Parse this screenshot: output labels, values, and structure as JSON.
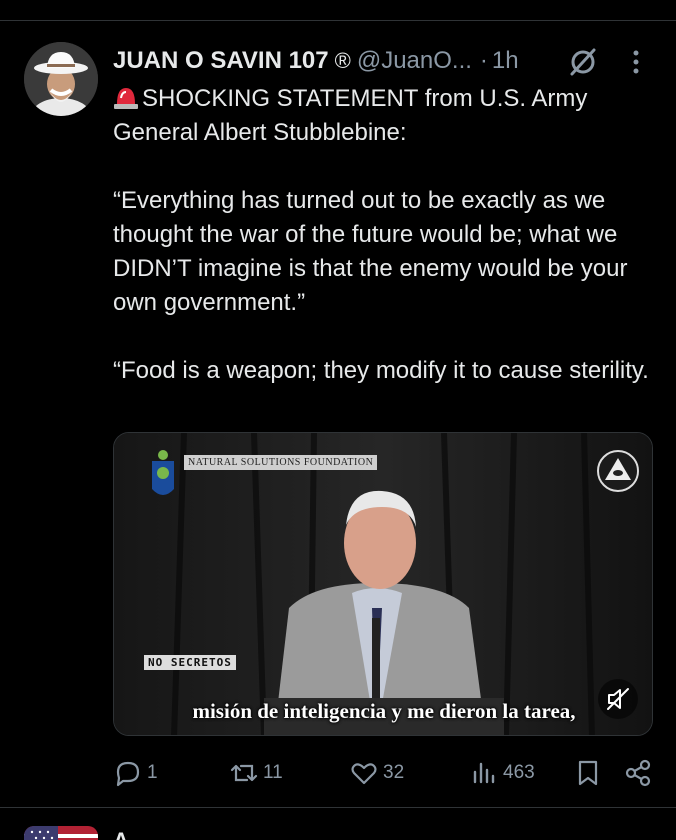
{
  "tweet": {
    "author_name": "JUAN O SAVIN 107",
    "registered_mark": "®",
    "handle": "@JuanO...",
    "separator": "·",
    "time": "1h",
    "paragraphs": [
      "SHOCKING STATEMENT from U.S. Army General Albert Stubblebine:",
      "“Everything has turned out to be exactly as we thought the war of the future would be; what we DIDN’T imagine is that the enemy would be your own government.”",
      "“Food is a weapon; they modify it to cause sterility."
    ],
    "media": {
      "org_name": "NATURAL SOLUTIONS FOUNDATION",
      "watermark": "NO SECRETOS",
      "caption": "misión de inteligencia y me dieron la tarea,"
    },
    "actions": {
      "replies": "1",
      "reposts": "11",
      "likes": "32",
      "views": "463"
    }
  },
  "next": {
    "name_fragment": "A"
  },
  "icons": {
    "siren": "siren-emoji-icon",
    "grok": "grok-icon",
    "more": "more-dots-icon",
    "reply": "reply-icon",
    "repost": "repost-icon",
    "like": "heart-icon",
    "views": "views-icon",
    "bookmark": "bookmark-icon",
    "share": "share-icon",
    "mute": "muted-speaker-icon"
  },
  "colors": {
    "background": "#000000",
    "text": "#e7e9ea",
    "secondary": "#8b98a5",
    "divider": "#2f3336"
  }
}
